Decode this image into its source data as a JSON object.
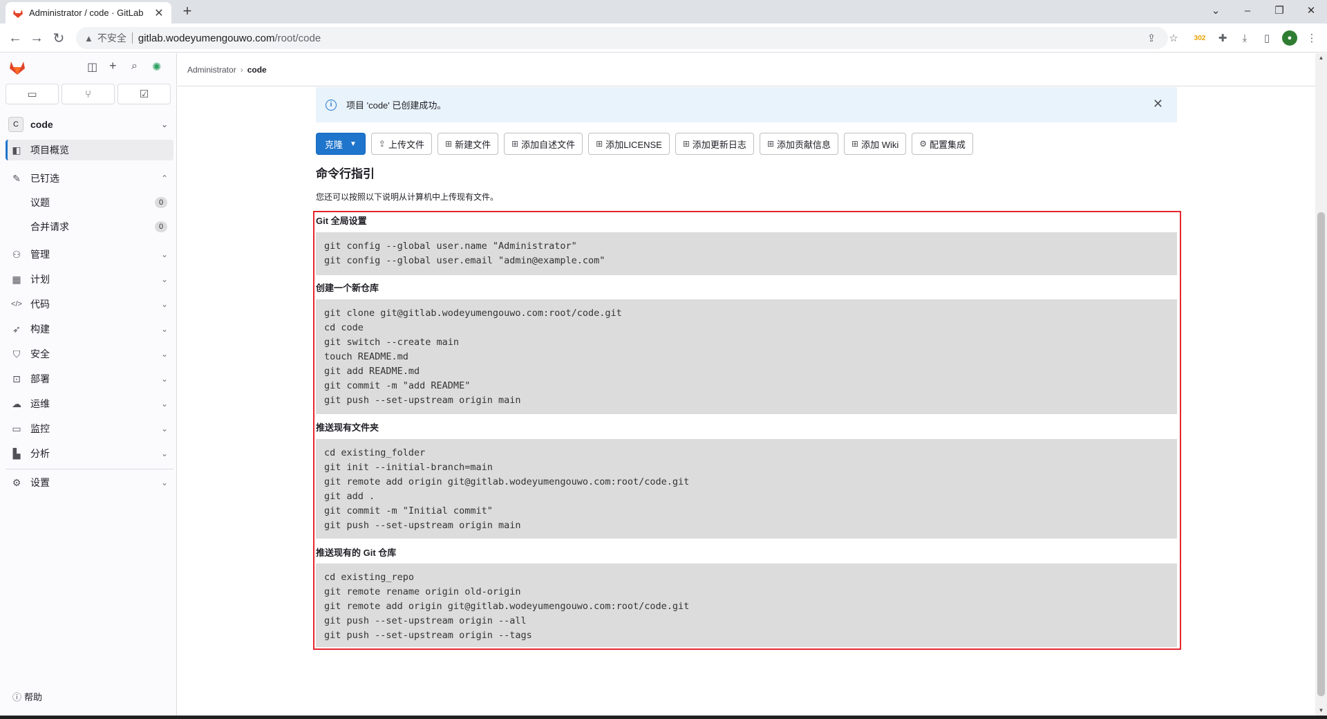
{
  "browser": {
    "tab_title": "Administrator / code · GitLab",
    "new_tab": "+",
    "security_label": "不安全",
    "url_host": "gitlab.wodeyumengouwo.com",
    "url_path": "/root/code",
    "ext_badge": "302"
  },
  "sidebar": {
    "project_avatar": "C",
    "project_name": "code",
    "overview": "项目概览",
    "pinned": "已钉选",
    "pinned_items": [
      {
        "label": "议题",
        "count": "0"
      },
      {
        "label": "合并请求",
        "count": "0"
      }
    ],
    "items": [
      "管理",
      "计划",
      "代码",
      "构建",
      "安全",
      "部署",
      "运维",
      "监控",
      "分析"
    ],
    "settings": "设置",
    "help": "帮助"
  },
  "breadcrumb": {
    "parent": "Administrator",
    "current": "code"
  },
  "alert": {
    "text": "项目 'code' 已创建成功。"
  },
  "actions": {
    "clone": "克隆",
    "upload": "上传文件",
    "new_file": "新建文件",
    "add_readme": "添加自述文件",
    "add_license": "添加LICENSE",
    "add_changelog": "添加更新日志",
    "add_contributing": "添加贡献信息",
    "add_wiki": "添加 Wiki",
    "configure": "配置集成"
  },
  "instructions": {
    "heading": "命令行指引",
    "intro": "您还可以按照以下说明从计算机中上传现有文件。",
    "sections": [
      {
        "title": "Git 全局设置",
        "code": "git config --global user.name \"Administrator\"\ngit config --global user.email \"admin@example.com\""
      },
      {
        "title": "创建一个新仓库",
        "code": "git clone git@gitlab.wodeyumengouwo.com:root/code.git\ncd code\ngit switch --create main\ntouch README.md\ngit add README.md\ngit commit -m \"add README\"\ngit push --set-upstream origin main"
      },
      {
        "title": "推送现有文件夹",
        "code": "cd existing_folder\ngit init --initial-branch=main\ngit remote add origin git@gitlab.wodeyumengouwo.com:root/code.git\ngit add .\ngit commit -m \"Initial commit\"\ngit push --set-upstream origin main"
      },
      {
        "title": "推送现有的 Git 仓库",
        "code": "cd existing_repo\ngit remote rename origin old-origin\ngit remote add origin git@gitlab.wodeyumengouwo.com:root/code.git\ngit push --set-upstream origin --all\ngit push --set-upstream origin --tags"
      }
    ]
  },
  "colors": {
    "accent": "#1f75cb",
    "highlight_border": "#e5262e",
    "gitlab_orange": "#e24329"
  }
}
